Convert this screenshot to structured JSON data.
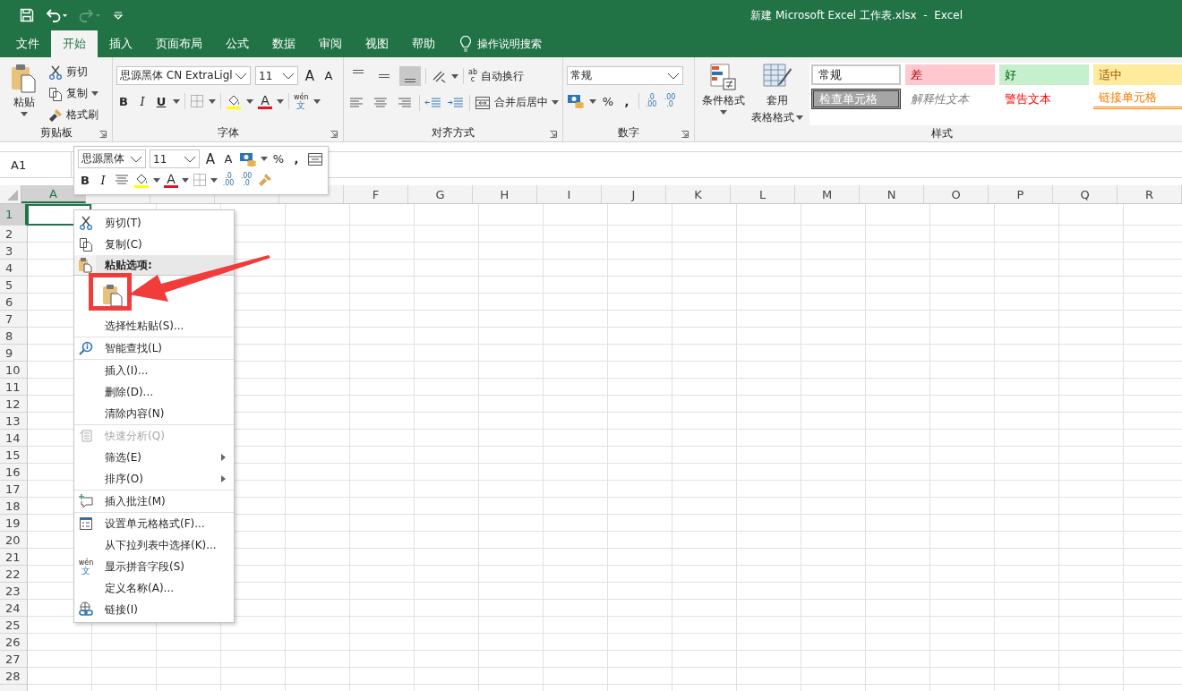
{
  "title_bar": {
    "title": "新建 Microsoft Excel 工作表.xlsx  -  Excel",
    "quick_access": [
      {
        "kind": "save",
        "disabled": false
      },
      {
        "kind": "undo",
        "disabled": false
      },
      {
        "kind": "redo",
        "disabled": true
      },
      {
        "kind": "customize",
        "disabled": false
      }
    ]
  },
  "tabs": [
    {
      "label": "文件",
      "selected": false
    },
    {
      "label": "开始",
      "selected": true
    },
    {
      "label": "插入",
      "selected": false
    },
    {
      "label": "页面布局",
      "selected": false
    },
    {
      "label": "公式",
      "selected": false
    },
    {
      "label": "数据",
      "selected": false
    },
    {
      "label": "审阅",
      "selected": false
    },
    {
      "label": "视图",
      "selected": false
    },
    {
      "label": "帮助",
      "selected": false
    }
  ],
  "tell_me": "操作说明搜索",
  "ribbon": {
    "clipboard": {
      "label": "剪贴板",
      "paste": "粘贴",
      "cut": "剪切",
      "copy": "复制",
      "format_painter": "格式刷"
    },
    "font": {
      "label": "字体",
      "font_name": "思源黑体 CN ExtraLigl",
      "font_size": "11",
      "grow_font": "A",
      "shrink_font": "A",
      "bold": "B",
      "italic": "I",
      "underline": "U",
      "font_color": "A",
      "phonetic": [
        "wén",
        "文"
      ]
    },
    "alignment": {
      "label": "对齐方式",
      "vertical_align": [
        {
          "selected": false
        },
        {
          "selected": false
        },
        {
          "selected": true
        }
      ],
      "wrap_icon": [
        "ab",
        "c"
      ],
      "wrap": "自动换行",
      "merge": "合并后居中"
    },
    "number": {
      "label": "数字",
      "format": "常规",
      "percent": "%",
      "comma": ",",
      "decimals": [
        {
          "top": ".0",
          "bottom": ".00"
        },
        {
          "top": ".00",
          "bottom": ".0"
        }
      ]
    },
    "styles": {
      "label": "样式",
      "conditional": "条件格式",
      "table_format": [
        "套用",
        "表格格式"
      ],
      "cells": [
        {
          "label": "常规",
          "kind": "normal"
        },
        {
          "label": "差",
          "kind": "bad"
        },
        {
          "label": "好",
          "kind": "good"
        },
        {
          "label": "适中",
          "kind": "neutral"
        },
        {
          "label": "检查单元格",
          "kind": "check"
        },
        {
          "label": "解释性文本",
          "kind": "explanatory"
        },
        {
          "label": "警告文本",
          "kind": "warning"
        },
        {
          "label": "链接单元格",
          "kind": "linked"
        }
      ]
    }
  },
  "name_box": "A1",
  "mini_toolbar": {
    "font_name": "思源黑体",
    "font_size": "11",
    "grow_font": "A",
    "shrink_font": "A",
    "percent": "%",
    "comma": ",",
    "bold": "B",
    "italic": "I",
    "font_color": "A",
    "decimals": [
      {
        "top": ".0",
        "bottom": ".00"
      },
      {
        "top": ".00",
        "bottom": ".0"
      }
    ]
  },
  "sheet": {
    "columns": [
      {
        "label": "A",
        "selected": true
      },
      {
        "selected": false
      },
      {
        "selected": false
      },
      {
        "selected": false
      },
      {
        "selected": false
      },
      {
        "label": "F",
        "selected": false
      },
      {
        "label": "G",
        "selected": false
      },
      {
        "label": "H",
        "selected": false
      },
      {
        "label": "I",
        "selected": false
      },
      {
        "label": "J",
        "selected": false
      },
      {
        "label": "K",
        "selected": false
      },
      {
        "label": "L",
        "selected": false
      },
      {
        "label": "M",
        "selected": false
      },
      {
        "label": "N",
        "selected": false
      },
      {
        "label": "O",
        "selected": false
      },
      {
        "label": "P",
        "selected": false
      },
      {
        "label": "Q",
        "selected": false
      },
      {
        "label": "R",
        "selected": false
      }
    ],
    "rows": [
      {
        "label": "1",
        "selected": true
      },
      {
        "label": "2",
        "selected": false
      },
      {
        "label": "3",
        "selected": false
      },
      {
        "label": "4",
        "selected": false
      },
      {
        "label": "5",
        "selected": false
      },
      {
        "label": "6",
        "selected": false
      },
      {
        "label": "7",
        "selected": false
      },
      {
        "label": "8",
        "selected": false
      },
      {
        "label": "9",
        "selected": false
      },
      {
        "label": "10",
        "selected": false
      },
      {
        "label": "11",
        "selected": false
      },
      {
        "label": "12",
        "selected": false
      },
      {
        "label": "13",
        "selected": false
      },
      {
        "label": "14",
        "selected": false
      },
      {
        "label": "15",
        "selected": false
      },
      {
        "label": "16",
        "selected": false
      },
      {
        "label": "17",
        "selected": false
      },
      {
        "label": "18",
        "selected": false
      },
      {
        "label": "19",
        "selected": false
      },
      {
        "label": "20",
        "selected": false
      },
      {
        "label": "21",
        "selected": false
      },
      {
        "label": "22",
        "selected": false
      },
      {
        "label": "23",
        "selected": false
      },
      {
        "label": "24",
        "selected": false
      },
      {
        "label": "25",
        "selected": false
      },
      {
        "label": "26",
        "selected": false
      },
      {
        "label": "27",
        "selected": false
      },
      {
        "label": "28",
        "selected": false
      }
    ]
  },
  "context_menu": {
    "items": [
      {
        "kind": "item",
        "label": "剪切(T)",
        "disabled": false,
        "submenu": false,
        "separator_before": false
      },
      {
        "kind": "item",
        "label": "复制(C)",
        "disabled": false,
        "submenu": false,
        "separator_before": false
      },
      {
        "kind": "header",
        "label": "粘贴选项:",
        "disabled": false,
        "submenu": false,
        "separator_before": false
      },
      {
        "kind": "paste_options",
        "disabled": false,
        "separator_before": false
      },
      {
        "kind": "item",
        "label": "选择性粘贴(S)...",
        "disabled": false,
        "submenu": false,
        "separator_before": false
      },
      {
        "kind": "item",
        "label": "智能查找(L)",
        "disabled": false,
        "submenu": false,
        "separator_before": true
      },
      {
        "kind": "item",
        "label": "插入(I)...",
        "disabled": false,
        "submenu": false,
        "separator_before": true
      },
      {
        "kind": "item",
        "label": "删除(D)...",
        "disabled": false,
        "submenu": false,
        "separator_before": false
      },
      {
        "kind": "item",
        "label": "清除内容(N)",
        "disabled": false,
        "submenu": false,
        "separator_before": false
      },
      {
        "kind": "item",
        "label": "快速分析(Q)",
        "disabled": true,
        "submenu": false,
        "separator_before": true
      },
      {
        "kind": "item",
        "label": "筛选(E)",
        "disabled": false,
        "submenu": true,
        "separator_before": false
      },
      {
        "kind": "item",
        "label": "排序(O)",
        "disabled": false,
        "submenu": true,
        "separator_before": false
      },
      {
        "kind": "item",
        "label": "插入批注(M)",
        "disabled": false,
        "submenu": false,
        "separator_before": true
      },
      {
        "kind": "item",
        "label": "设置单元格格式(F)...",
        "disabled": false,
        "submenu": false,
        "separator_before": true
      },
      {
        "kind": "item",
        "label": "从下拉列表中选择(K)...",
        "disabled": false,
        "submenu": false,
        "separator_before": false
      },
      {
        "kind": "item",
        "label": "显示拼音字段(S)",
        "icon_text": [
          "wén",
          "文"
        ],
        "disabled": false,
        "submenu": false,
        "separator_before": false
      },
      {
        "kind": "item",
        "label": "定义名称(A)...",
        "disabled": false,
        "submenu": false,
        "separator_before": false
      },
      {
        "kind": "item",
        "label": "链接(I)",
        "disabled": false,
        "submenu": false,
        "separator_before": false
      }
    ]
  }
}
